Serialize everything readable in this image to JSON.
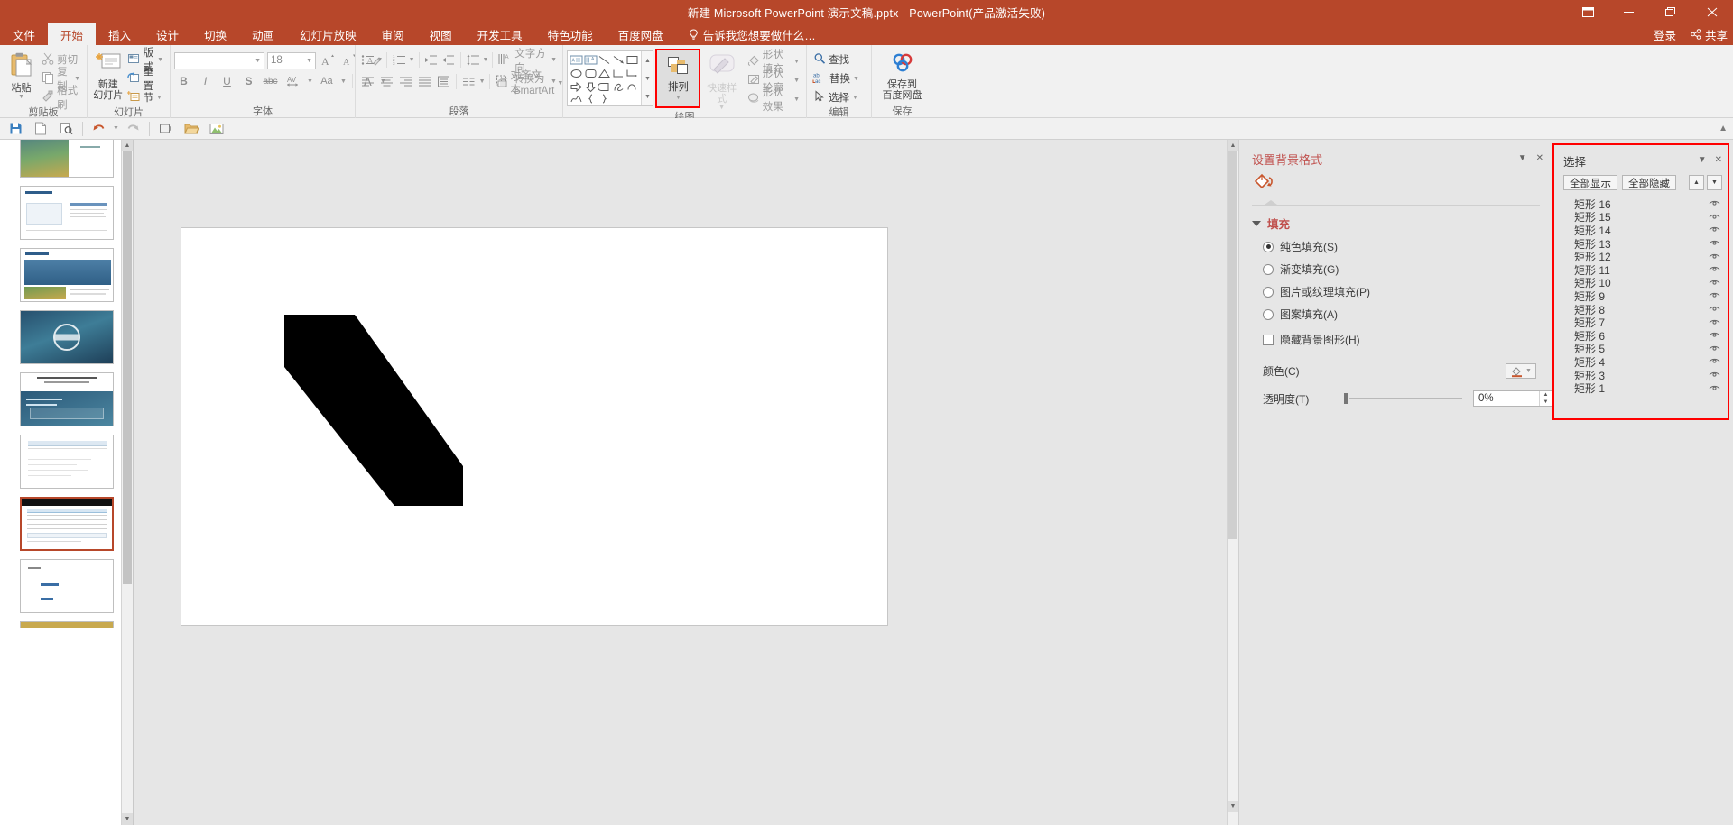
{
  "window": {
    "title": "新建 Microsoft PowerPoint 演示文稿.pptx - PowerPoint(产品激活失败)",
    "buttons": {
      "ribbon_display": "ribbon-display-options-icon",
      "minimize": "minimize-icon",
      "restore": "restore-icon",
      "close": "close-icon"
    }
  },
  "tabs": [
    {
      "label": "文件",
      "active": false
    },
    {
      "label": "开始",
      "active": true
    },
    {
      "label": "插入",
      "active": false
    },
    {
      "label": "设计",
      "active": false
    },
    {
      "label": "切换",
      "active": false
    },
    {
      "label": "动画",
      "active": false
    },
    {
      "label": "幻灯片放映",
      "active": false
    },
    {
      "label": "审阅",
      "active": false
    },
    {
      "label": "视图",
      "active": false
    },
    {
      "label": "开发工具",
      "active": false
    },
    {
      "label": "特色功能",
      "active": false
    },
    {
      "label": "百度网盘",
      "active": false
    }
  ],
  "tell_me": "告诉我您想要做什么…",
  "account": {
    "signin": "登录",
    "share": "共享"
  },
  "ribbon": {
    "groups": [
      {
        "name": "剪贴板",
        "big": {
          "label": "粘贴",
          "icon": "paste-icon"
        },
        "items": [
          {
            "label": "剪切",
            "icon": "cut-icon",
            "dropdown": false
          },
          {
            "label": "复制",
            "icon": "copy-icon",
            "dropdown": true
          },
          {
            "label": "格式刷",
            "icon": "format-painter-icon",
            "dropdown": false
          }
        ]
      },
      {
        "name": "幻灯片",
        "big": {
          "label": "新建\n幻灯片",
          "icon": "new-slide-icon"
        },
        "items": [
          {
            "label": "版式",
            "icon": "layout-icon",
            "dropdown": true
          },
          {
            "label": "重置",
            "icon": "reset-icon",
            "dropdown": false
          },
          {
            "label": "节",
            "icon": "section-icon",
            "dropdown": true
          }
        ]
      },
      {
        "name": "字体",
        "font_name": "",
        "font_size": "18",
        "buttons": [
          "B",
          "I",
          "U",
          "S",
          "abc",
          "AV",
          "Aa",
          "A"
        ],
        "size_buttons": [
          "A▲",
          "A▼",
          "clear-format"
        ]
      },
      {
        "name": "段落",
        "text_direction": "文字方向",
        "align_text": "对齐文本",
        "convert_smartart": "转换为 SmartArt"
      },
      {
        "name": "绘图",
        "arrange": "排列",
        "quick_styles": "快速样式",
        "shape_fill": "形状填充",
        "shape_outline": "形状轮廓",
        "shape_effects": "形状效果",
        "highlighted": "排列"
      },
      {
        "name": "编辑",
        "items": [
          {
            "label": "查找",
            "icon": "search-icon",
            "dropdown": false
          },
          {
            "label": "替换",
            "icon": "replace-icon",
            "dropdown": true
          },
          {
            "label": "选择",
            "icon": "select-icon",
            "dropdown": true
          }
        ]
      },
      {
        "name": "保存",
        "big": {
          "label": "保存到\n百度网盘",
          "icon": "baidu-netdisk-icon"
        }
      }
    ]
  },
  "quick_toolbar": [
    {
      "name": "save-icon"
    },
    {
      "name": "new-icon"
    },
    {
      "name": "preview-icon"
    },
    {
      "name": "undo-icon"
    },
    {
      "name": "redo-icon"
    },
    {
      "name": "record-icon"
    },
    {
      "name": "open-icon"
    },
    {
      "name": "picture-icon"
    }
  ],
  "thumbnails": [
    {
      "index": 1,
      "selected": false
    },
    {
      "index": 2,
      "selected": false
    },
    {
      "index": 3,
      "selected": false
    },
    {
      "index": 4,
      "selected": false
    },
    {
      "index": 5,
      "selected": false
    },
    {
      "index": 6,
      "selected": false
    },
    {
      "index": 7,
      "selected": true
    },
    {
      "index": 8,
      "selected": false
    },
    {
      "index": 9,
      "selected": false
    }
  ],
  "format_pane": {
    "title": "设置背景格式",
    "section": "填充",
    "options": [
      {
        "label": "纯色填充(S)",
        "selected": true
      },
      {
        "label": "渐变填充(G)",
        "selected": false
      },
      {
        "label": "图片或纹理填充(P)",
        "selected": false
      },
      {
        "label": "图案填充(A)",
        "selected": false
      }
    ],
    "checkbox": {
      "label": "隐藏背景图形(H)",
      "checked": false
    },
    "color_label": "颜色(C)",
    "transparency_label": "透明度(T)",
    "transparency_value": "0%"
  },
  "selection_pane": {
    "title": "选择",
    "show_all": "全部显示",
    "hide_all": "全部隐藏",
    "items": [
      "矩形 16",
      "矩形 15",
      "矩形 14",
      "矩形 13",
      "矩形 12",
      "矩形 11",
      "矩形 10",
      "矩形 9",
      "矩形 8",
      "矩形 7",
      "矩形 6",
      "矩形 5",
      "矩形 4",
      "矩形 3",
      "矩形 1"
    ]
  },
  "colors": {
    "accent": "#b7472a",
    "highlight": "#ff0000",
    "pane_bg": "#e6e6e6",
    "ribbon_bg": "#f1f1f1"
  }
}
